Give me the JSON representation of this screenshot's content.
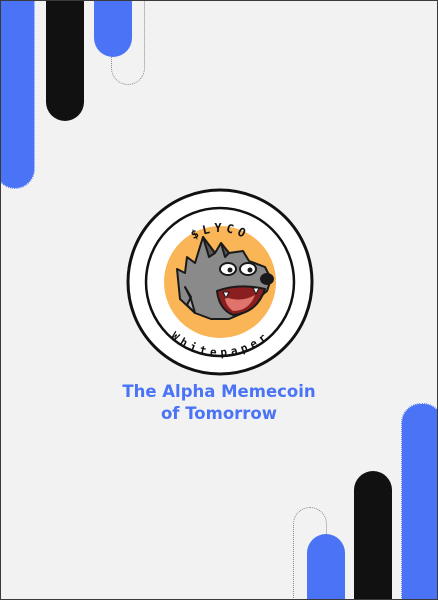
{
  "colors": {
    "page_background": "#f2f2f2",
    "accent_blue": "#4a74f5",
    "black": "#111111",
    "logo_badge": "#f9b556"
  },
  "logo": {
    "ticker": "$LYCO",
    "label": "Whitepaper",
    "mascot": "wolf-head-icon"
  },
  "headline": {
    "line1": "The Alpha Memecoin",
    "line2": "of Tomorrow"
  }
}
